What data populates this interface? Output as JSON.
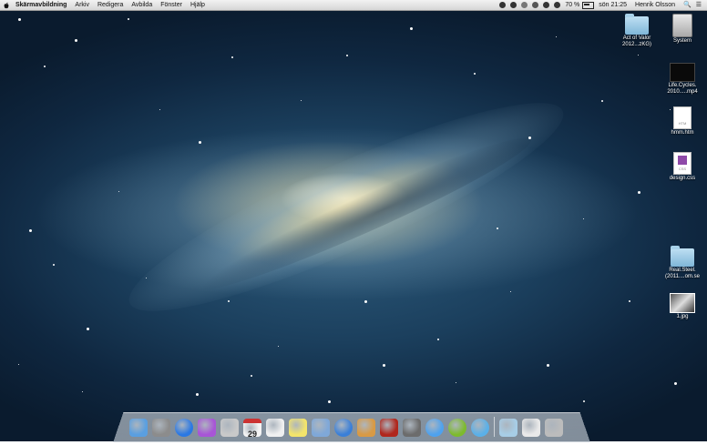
{
  "menubar": {
    "app_name": "Skärmavbildning",
    "menus": [
      "Arkiv",
      "Redigera",
      "Avbilda",
      "Fönster",
      "Hjälp"
    ],
    "battery": "70 %",
    "clock": "sön 21:25",
    "user": "Henrik Olsson"
  },
  "desktop_icons": [
    {
      "label": "Act of Valor 2012...zKG)",
      "kind": "folder"
    },
    {
      "label": "System",
      "kind": "disk"
    },
    {
      "label": "Life.Cycles. 2010.....mp4",
      "kind": "video"
    },
    {
      "label": "hmm.htm",
      "kind": "htm"
    },
    {
      "label": "design.css",
      "kind": "css"
    },
    {
      "label": "Real.Steel. (2011....om.se",
      "kind": "folder"
    },
    {
      "label": "1.jpg",
      "kind": "photo"
    }
  ],
  "doc_tags": {
    "htm": "HTM",
    "css": "CSS"
  },
  "calendar_day": "29",
  "dock": [
    {
      "name": "finder-icon",
      "color": "#5a9fe0"
    },
    {
      "name": "system-preferences-icon",
      "color": "#8c8c8c"
    },
    {
      "name": "app-store-icon",
      "color": "#2a78e4"
    },
    {
      "name": "itunes-lp-icon",
      "color": "#a855d6"
    },
    {
      "name": "grab-scissors-icon",
      "color": "#c9c9c9"
    },
    {
      "name": "calendar-icon",
      "color": "#f4f4f4"
    },
    {
      "name": "reminders-icon",
      "color": "#f0f0f0"
    },
    {
      "name": "stickies-icon",
      "color": "#f3e46b"
    },
    {
      "name": "preview-icon",
      "color": "#7fa8d8"
    },
    {
      "name": "itunes-icon",
      "color": "#3a7fd8"
    },
    {
      "name": "iphoto-icon",
      "color": "#d89a45"
    },
    {
      "name": "photo-booth-icon",
      "color": "#b0271d"
    },
    {
      "name": "facetime-icon",
      "color": "#6c6c6c"
    },
    {
      "name": "messages-icon",
      "color": "#4ea2ee"
    },
    {
      "name": "spotify-icon",
      "color": "#7dbb2d"
    },
    {
      "name": "safari-icon",
      "color": "#5ab0e8"
    },
    {
      "name": "downloads-folder-icon",
      "color": "#a7cde6"
    },
    {
      "name": "documents-stack-icon",
      "color": "#e9e9e9"
    },
    {
      "name": "trash-icon",
      "color": "#bcbcbc"
    }
  ]
}
